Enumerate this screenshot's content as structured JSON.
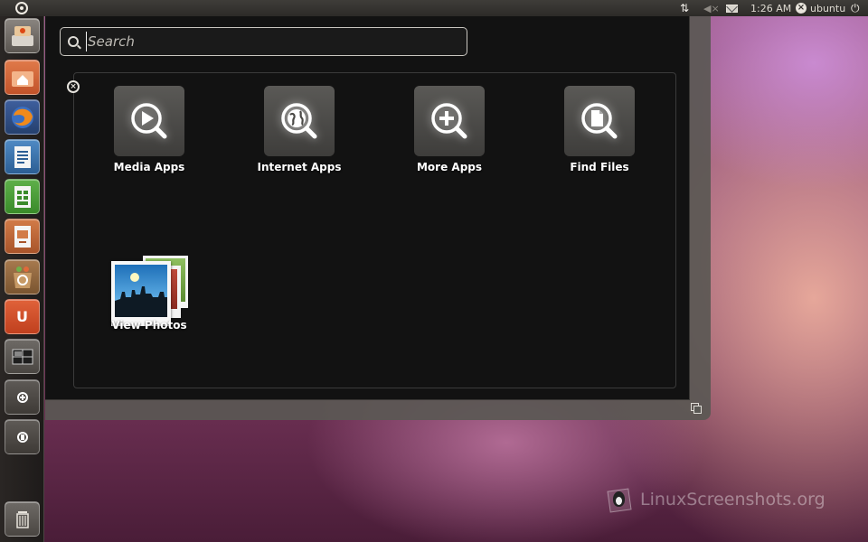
{
  "colors": {
    "dash_background": "#121212",
    "panel_background": "#2d2b28",
    "accent_orange": "#dd4814"
  },
  "top_panel": {
    "bfb_icon": "ubuntu-logo-icon",
    "network_icon": "network-icon",
    "volume_icon": "volume-muted-icon",
    "mail_icon": "mail-icon",
    "clock": "1:26 AM",
    "user_name": "ubuntu",
    "power_icon": "power-icon"
  },
  "launcher": {
    "items": [
      {
        "id": "installer",
        "icon": "installer-icon"
      },
      {
        "id": "home-folder",
        "icon": "home-folder-icon"
      },
      {
        "id": "firefox",
        "icon": "firefox-icon"
      },
      {
        "id": "writer",
        "icon": "writer-icon"
      },
      {
        "id": "calc",
        "icon": "calc-icon"
      },
      {
        "id": "impress",
        "icon": "impress-icon"
      },
      {
        "id": "software-center",
        "icon": "software-center-icon"
      },
      {
        "id": "ubuntu-one",
        "icon": "ubuntu-one-icon",
        "glyph": "U"
      },
      {
        "id": "workspaces",
        "icon": "workspace-switcher-icon"
      },
      {
        "id": "applications",
        "icon": "applications-lens-icon"
      },
      {
        "id": "files",
        "icon": "files-lens-icon"
      },
      {
        "id": "trash",
        "icon": "trash-icon"
      }
    ]
  },
  "dash": {
    "search": {
      "placeholder": "Search",
      "value": ""
    },
    "shortcuts": [
      {
        "label": "Media Apps",
        "icon": "media-apps-icon"
      },
      {
        "label": "Internet Apps",
        "icon": "internet-apps-icon"
      },
      {
        "label": "More Apps",
        "icon": "more-apps-icon"
      },
      {
        "label": "Find Files",
        "icon": "find-files-icon"
      },
      {
        "label": "View Photos",
        "icon": "photos-icon"
      }
    ]
  },
  "watermark": {
    "text": "LinuxScreenshots.org"
  }
}
